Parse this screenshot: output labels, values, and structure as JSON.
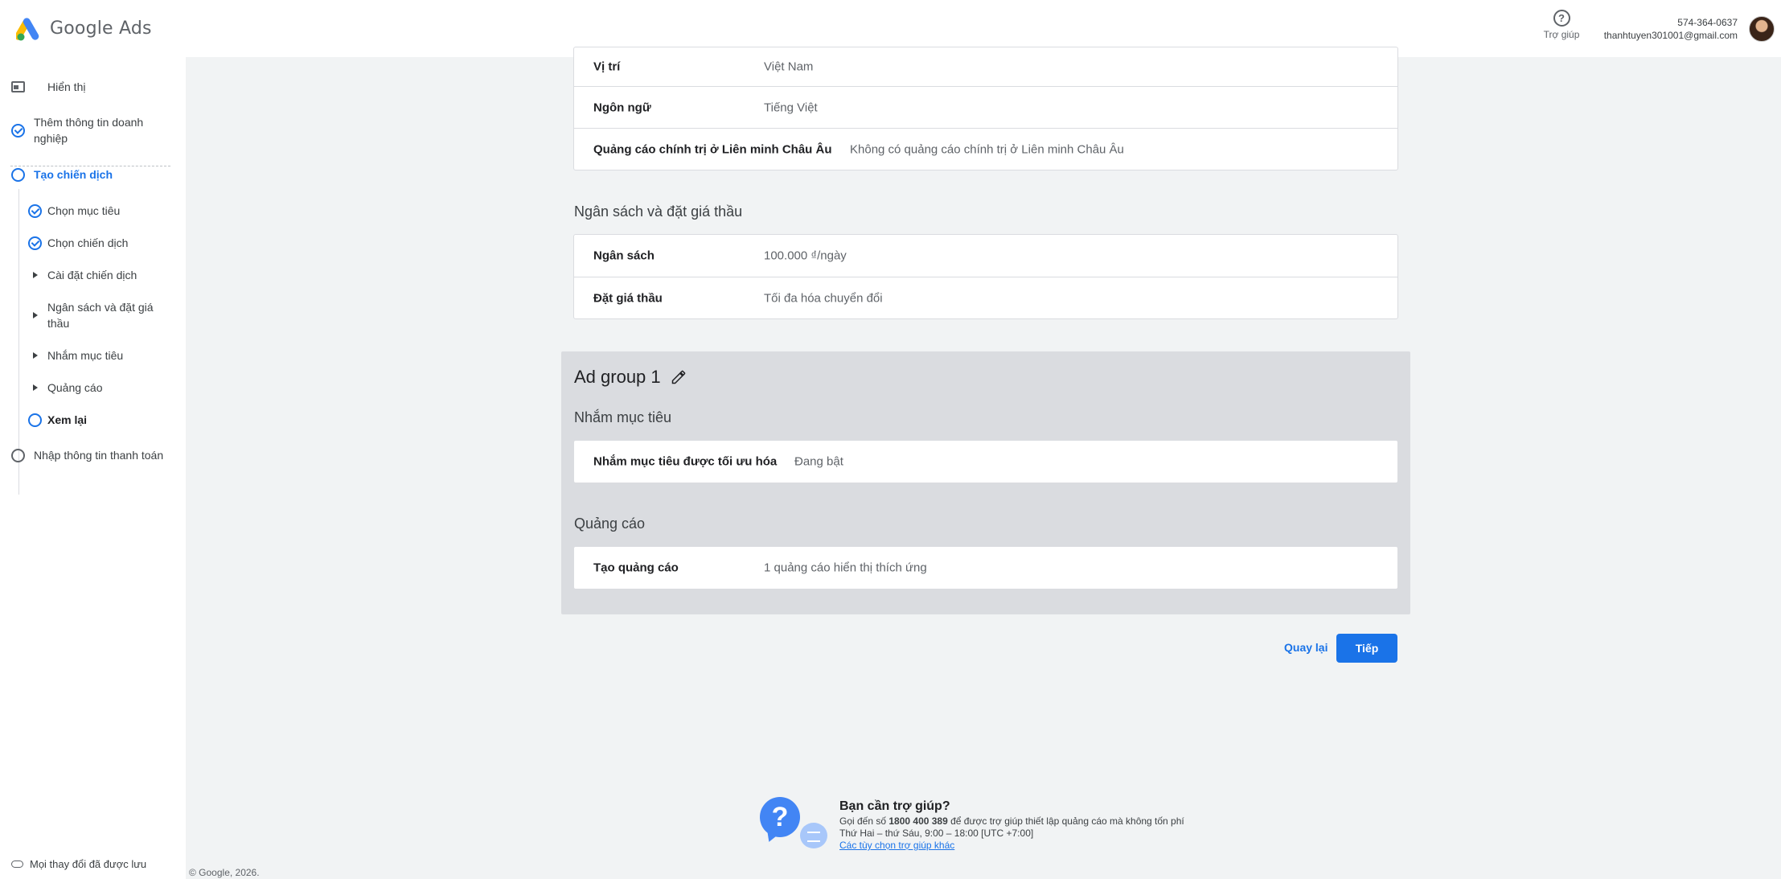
{
  "header": {
    "logo_text": "Google Ads",
    "help_label": "Trợ giúp",
    "help_icon": "?",
    "phone": "574-364-0637",
    "email": "thanhtuyen301001@gmail.com"
  },
  "sidebar": {
    "items": [
      {
        "label": "Hiển thị"
      },
      {
        "label": "Thêm thông tin doanh nghiệp"
      },
      {
        "label": "Tạo chiến dịch"
      },
      {
        "label": "Chọn mục tiêu"
      },
      {
        "label": "Chọn chiến dịch"
      },
      {
        "label": "Cài đặt chiến dịch"
      },
      {
        "label": "Ngân sách và đặt giá thầu"
      },
      {
        "label": "Nhắm mục tiêu"
      },
      {
        "label": "Quảng cáo"
      },
      {
        "label": "Xem lại"
      },
      {
        "label": "Nhập thông tin thanh toán"
      }
    ],
    "saved_text": "Mọi thay đổi đã được lưu"
  },
  "settings": {
    "rows": [
      {
        "label": "Vị trí",
        "value": "Việt Nam"
      },
      {
        "label": "Ngôn ngữ",
        "value": "Tiếng Việt"
      },
      {
        "label": "Quảng cáo chính trị ở Liên minh Châu Âu",
        "value": "Không có quảng cáo chính trị ở Liên minh Châu Âu"
      }
    ]
  },
  "budget": {
    "title": "Ngân sách và đặt giá thầu",
    "rows": [
      {
        "label": "Ngân sách",
        "value": "100.000 ₫/ngày"
      },
      {
        "label": "Đặt giá thầu",
        "value": "Tối đa hóa chuyển đổi"
      }
    ]
  },
  "ad_group": {
    "title": "Ad group 1",
    "targeting_title": "Nhắm mục tiêu",
    "targeting_row": {
      "label": "Nhắm mục tiêu được tối ưu hóa",
      "value": "Đang bật"
    },
    "ads_title": "Quảng cáo",
    "ads_row": {
      "label": "Tạo quảng cáo",
      "value": "1 quảng cáo hiển thị thích ứng"
    }
  },
  "actions": {
    "back": "Quay lại",
    "next": "Tiếp"
  },
  "help_footer": {
    "title": "Bạn cần trợ giúp?",
    "line1_pre": "Gọi đến số ",
    "phone": "1800 400 389",
    "line1_post": " để được trợ giúp thiết lập quảng cáo mà không tốn phí",
    "hours": "Thứ Hai – thứ Sáu, 9:00 – 18:00 [UTC +7:00]",
    "link": "Các tùy chọn trợ giúp khác"
  },
  "copyright": "© Google, 2026.",
  "colors": {
    "accent": "#1a73e8",
    "background": "#f1f3f4"
  }
}
